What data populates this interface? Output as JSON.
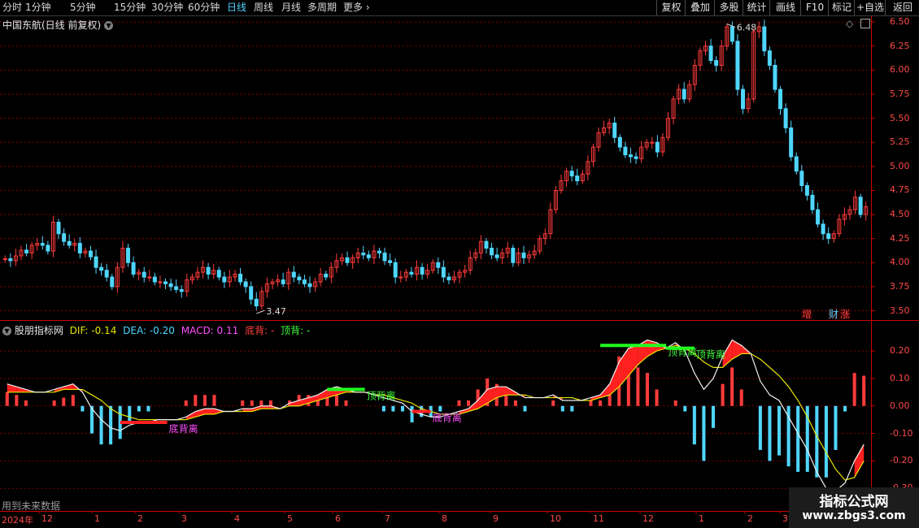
{
  "toolbar": {
    "periods": [
      "分时",
      "1分钟",
      "5分钟",
      "15分钟",
      "30分钟",
      "60分钟",
      "日线",
      "周线",
      "月线",
      "多周期"
    ],
    "active": "日线",
    "more": "更多",
    "right": [
      "复权",
      "叠加",
      "多股",
      "统计",
      "画线",
      "F10",
      "标记",
      "+自选",
      "返回"
    ]
  },
  "main_panel": {
    "title": "中国东航(日线 前复权)",
    "high_label": "6.48",
    "low_label": "3.47",
    "tags": [
      "增",
      "财",
      "涨"
    ]
  },
  "indicator_panel": {
    "name": "股朋指标网",
    "dif_label": "DIF: -0.14",
    "dea_label": "DEA: -0.20",
    "macd_label": "MACD: 0.11",
    "bottom_div_label": "底背: -",
    "top_div_label": "顶背: -",
    "div_labels": {
      "top": "顶背离",
      "bottom": "底背离"
    },
    "future_data": "用到未来数据"
  },
  "x_axis": {
    "year": "2024年",
    "months": [
      "12",
      "1",
      "2",
      "3",
      "4",
      "5",
      "6",
      "7",
      "8",
      "9",
      "10",
      "11",
      "12",
      "1",
      "2",
      "3"
    ]
  },
  "watermark": {
    "title": "指标公式网",
    "url": "www.zbgs3.com"
  },
  "colors": {
    "up": "#ff3b3b",
    "down": "#4fd6ff",
    "dif": "#f0f0f0",
    "dea": "#e6e600",
    "grid": "#7a0000",
    "axis": "#cc0000"
  },
  "chart_data": [
    {
      "type": "candlestick",
      "title": "中国东航(日线 前复权)",
      "yticks": [
        3.5,
        3.75,
        4.0,
        4.25,
        4.5,
        4.75,
        5.0,
        5.25,
        5.5,
        5.75,
        6.0,
        6.25,
        6.5
      ],
      "ylim": [
        3.42,
        6.56
      ],
      "max": {
        "value": 6.48
      },
      "min": {
        "value": 3.47
      },
      "series": [
        {
          "values": [
            4.04,
            4.02,
            4.07,
            4.13,
            4.1,
            4.18,
            4.2,
            4.18,
            4.12,
            4.42,
            4.3,
            4.22,
            4.18,
            4.2,
            4.1,
            4.12,
            4.06,
            3.95,
            3.92,
            3.85,
            3.75,
            3.95,
            4.15,
            4.0,
            3.88,
            3.9,
            3.85,
            3.85,
            3.8,
            3.8,
            3.78,
            3.75,
            3.72,
            3.7,
            3.82,
            3.85,
            3.9,
            3.95,
            3.88,
            3.92,
            3.85,
            3.8,
            3.85,
            3.88,
            3.8,
            3.75,
            3.62,
            3.55,
            3.7,
            3.78,
            3.8,
            3.82,
            3.78,
            3.9,
            3.85,
            3.82,
            3.78,
            3.75,
            3.8,
            3.88,
            3.85,
            3.95,
            4.02,
            4.05,
            4.0,
            4.05,
            4.1,
            4.08,
            4.05,
            4.12,
            4.1,
            4.02,
            4.0,
            3.85,
            3.85,
            3.9,
            3.88,
            3.95,
            3.88,
            3.92,
            4.0,
            3.95,
            3.85,
            3.82,
            3.85,
            3.9,
            3.92,
            4.05,
            4.1,
            4.22,
            4.15,
            4.08,
            4.05,
            4.1,
            4.15,
            4.0,
            4.1,
            4.05,
            4.08,
            4.12,
            4.25,
            4.3,
            4.55,
            4.75,
            4.85,
            4.95,
            4.9,
            4.85,
            4.92,
            5.05,
            5.2,
            5.35,
            5.4,
            5.45,
            5.3,
            5.2,
            5.12,
            5.1,
            5.08,
            5.2,
            5.25,
            5.25,
            5.15,
            5.3,
            5.5,
            5.7,
            5.8,
            5.7,
            5.85,
            6.05,
            6.2,
            6.25,
            6.1,
            6.05,
            6.25,
            6.45,
            6.3,
            5.8,
            5.6,
            5.7,
            6.4,
            6.45,
            6.2,
            6.05,
            5.8,
            5.6,
            5.4,
            5.1,
            4.95,
            4.8,
            4.7,
            4.55,
            4.4,
            4.3,
            4.25,
            4.3,
            4.45,
            4.5,
            4.55,
            4.68,
            4.5,
            4.58
          ]
        }
      ]
    },
    {
      "type": "bar+line",
      "title": "股朋指标网",
      "yticks": [
        0.2,
        0.1,
        0.0,
        -0.1,
        -0.2,
        -0.3
      ],
      "ylim": [
        -0.32,
        0.28
      ],
      "series": [
        {
          "name": "DIF",
          "values": [
            0.08,
            0.07,
            0.06,
            0.05,
            0.05,
            0.06,
            0.07,
            0.08,
            0.05,
            -0.01,
            -0.05,
            -0.08,
            -0.09,
            -0.07,
            -0.06,
            -0.06,
            -0.05,
            -0.05,
            -0.05,
            -0.04,
            -0.02,
            -0.01,
            -0.01,
            -0.02,
            -0.02,
            -0.01,
            -0.01,
            0.0,
            0.0,
            -0.01,
            0.01,
            0.02,
            0.03,
            0.04,
            0.06,
            0.07,
            0.06,
            0.05,
            0.05,
            0.04,
            0.03,
            0.02,
            0.01,
            -0.02,
            -0.03,
            -0.04,
            -0.04,
            -0.03,
            -0.02,
            -0.01,
            0.02,
            0.06,
            0.07,
            0.07,
            0.05,
            0.03,
            0.03,
            0.03,
            0.04,
            0.02,
            0.02,
            0.02,
            0.03,
            0.04,
            0.08,
            0.16,
            0.21,
            0.22,
            0.24,
            0.23,
            0.21,
            0.23,
            0.2,
            0.12,
            0.06,
            0.1,
            0.18,
            0.24,
            0.22,
            0.19,
            0.09,
            0.04,
            0.02,
            -0.04,
            -0.1,
            -0.16,
            -0.24,
            -0.3,
            -0.31,
            -0.28,
            -0.2,
            -0.14
          ]
        },
        {
          "name": "DEA",
          "values": [
            0.05,
            0.05,
            0.05,
            0.05,
            0.05,
            0.05,
            0.06,
            0.06,
            0.06,
            0.04,
            0.02,
            -0.01,
            -0.03,
            -0.04,
            -0.05,
            -0.05,
            -0.05,
            -0.05,
            -0.05,
            -0.05,
            -0.04,
            -0.03,
            -0.03,
            -0.02,
            -0.02,
            -0.02,
            -0.02,
            -0.01,
            -0.01,
            -0.01,
            0.0,
            0.0,
            0.01,
            0.02,
            0.03,
            0.04,
            0.05,
            0.05,
            0.05,
            0.04,
            0.04,
            0.03,
            0.02,
            0.01,
            -0.01,
            -0.02,
            -0.03,
            -0.03,
            -0.03,
            -0.02,
            -0.01,
            0.01,
            0.03,
            0.04,
            0.04,
            0.04,
            0.03,
            0.03,
            0.03,
            0.03,
            0.03,
            0.02,
            0.02,
            0.03,
            0.04,
            0.07,
            0.11,
            0.15,
            0.18,
            0.2,
            0.21,
            0.22,
            0.21,
            0.19,
            0.16,
            0.14,
            0.14,
            0.17,
            0.19,
            0.19,
            0.17,
            0.14,
            0.11,
            0.07,
            0.02,
            -0.04,
            -0.11,
            -0.17,
            -0.23,
            -0.27,
            -0.26,
            -0.2
          ]
        },
        {
          "name": "MACD",
          "values": [
            0.05,
            0.04,
            0.02,
            0.0,
            0.0,
            0.02,
            0.03,
            0.04,
            -0.02,
            -0.1,
            -0.14,
            -0.14,
            -0.12,
            -0.06,
            -0.02,
            -0.02,
            0.0,
            0.0,
            0.0,
            0.02,
            0.04,
            0.04,
            0.04,
            0.0,
            0.0,
            0.02,
            0.02,
            0.02,
            0.02,
            0.0,
            0.02,
            0.04,
            0.04,
            0.04,
            0.06,
            0.06,
            0.02,
            0.0,
            0.0,
            0.0,
            -0.02,
            -0.02,
            -0.02,
            -0.06,
            -0.04,
            -0.04,
            -0.02,
            0.0,
            0.02,
            0.02,
            0.06,
            0.1,
            0.08,
            0.06,
            0.02,
            -0.02,
            0.0,
            0.0,
            0.02,
            -0.02,
            -0.02,
            0.0,
            0.02,
            0.02,
            0.08,
            0.18,
            0.2,
            0.14,
            0.12,
            0.06,
            0.0,
            0.02,
            -0.02,
            -0.14,
            -0.2,
            -0.08,
            0.08,
            0.14,
            0.06,
            0.0,
            -0.16,
            -0.2,
            -0.18,
            -0.22,
            -0.24,
            -0.24,
            -0.26,
            -0.26,
            -0.16,
            -0.02,
            0.12,
            0.11
          ]
        }
      ]
    }
  ]
}
